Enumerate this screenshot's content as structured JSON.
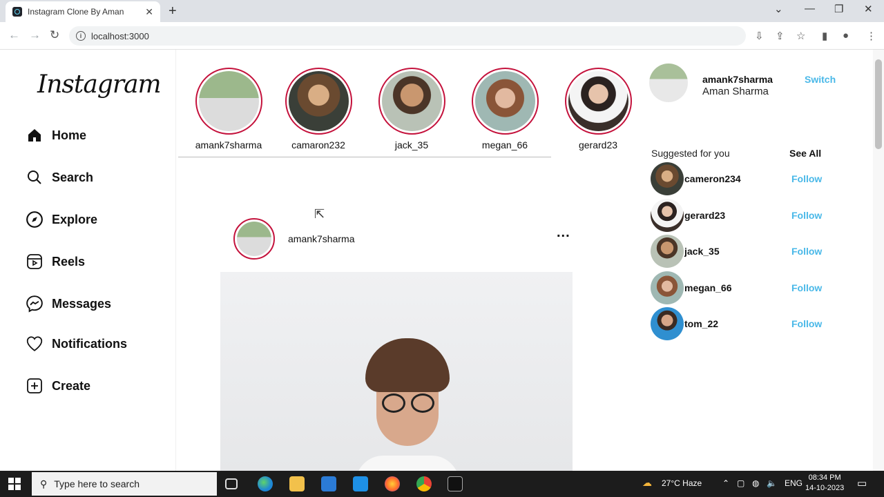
{
  "browser": {
    "tab_title": "Instagram Clone By Aman",
    "tab_close": "✕",
    "new_tab": "+",
    "url": "localhost:3000"
  },
  "sidebar": {
    "logo": "Instagram",
    "items": [
      {
        "label": "Home",
        "icon": "home-icon"
      },
      {
        "label": "Search",
        "icon": "search-icon"
      },
      {
        "label": "Explore",
        "icon": "compass-icon"
      },
      {
        "label": "Reels",
        "icon": "reels-icon"
      },
      {
        "label": "Messages",
        "icon": "messenger-icon"
      },
      {
        "label": "Notifications",
        "icon": "heart-icon"
      },
      {
        "label": "Create",
        "icon": "plus-square-icon"
      }
    ]
  },
  "stories": [
    {
      "username": "amank7sharma"
    },
    {
      "username": "camaron232"
    },
    {
      "username": "jack_35"
    },
    {
      "username": "megan_66"
    },
    {
      "username": "gerard23"
    }
  ],
  "post": {
    "username": "amank7sharma",
    "more": "..."
  },
  "current_user": {
    "username": "amank7sharma",
    "name": "Aman Sharma",
    "switch_label": "Switch"
  },
  "suggestions": {
    "title": "Suggested for you",
    "see_all": "See All",
    "follow_label": "Follow",
    "users": [
      {
        "username": "cameron234"
      },
      {
        "username": "gerard23"
      },
      {
        "username": "jack_35"
      },
      {
        "username": "megan_66"
      },
      {
        "username": "tom_22"
      }
    ]
  },
  "taskbar": {
    "search_placeholder": "Type here to search",
    "weather": "27°C  Haze",
    "language": "ENG",
    "time": "08:34 PM",
    "date": "14-10-2023"
  },
  "colors": {
    "accent": "#49b8e8",
    "story_ring": "#c4123c"
  }
}
